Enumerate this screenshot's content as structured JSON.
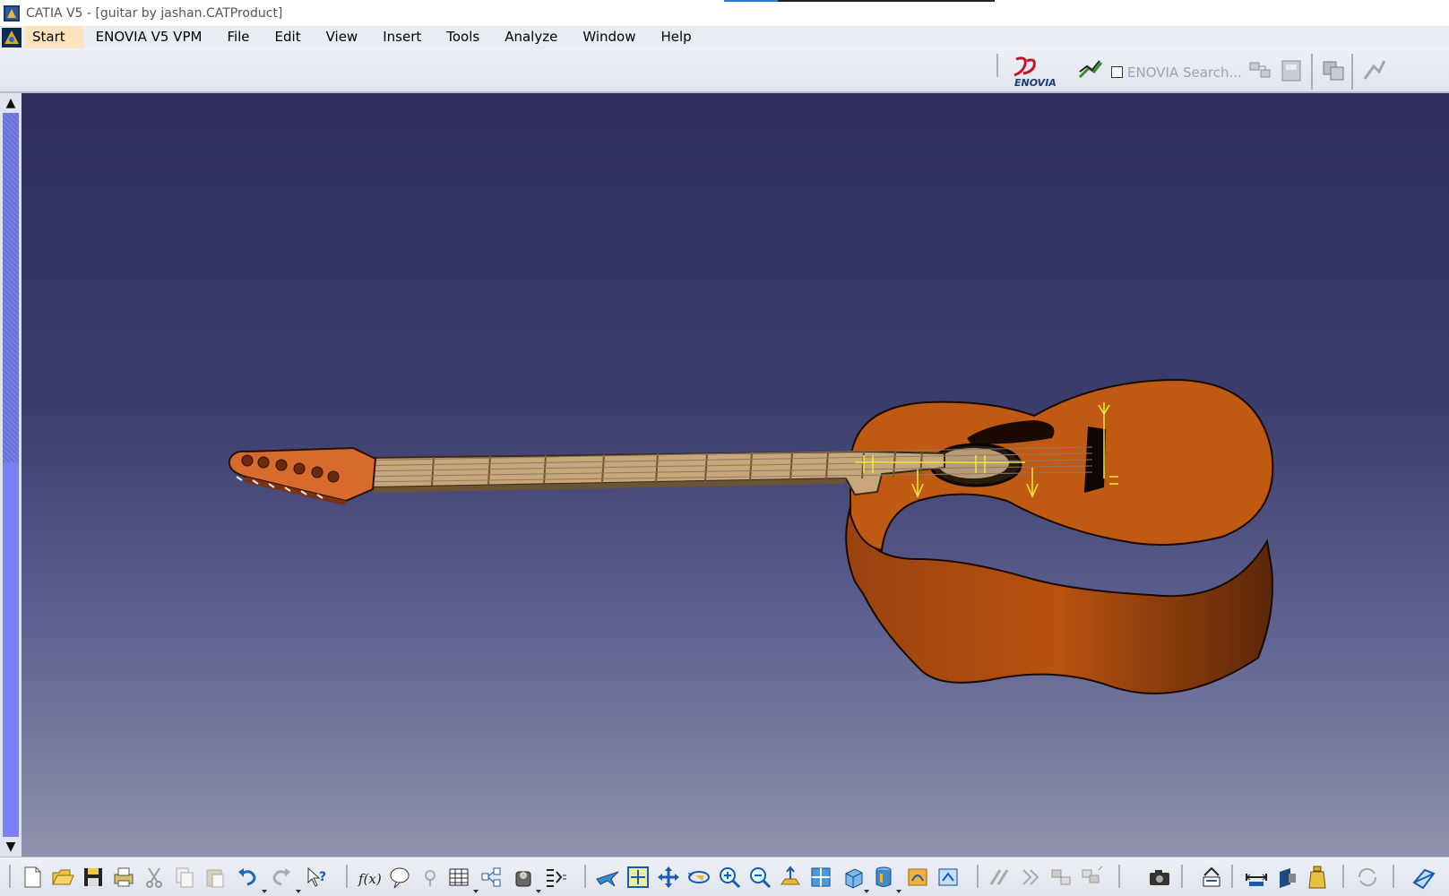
{
  "window": {
    "title": "CATIA V5 - [guitar by jashan.CATProduct]"
  },
  "menu": {
    "items": [
      {
        "label": "Start",
        "active": true
      },
      {
        "label": "ENOVIA V5 VPM"
      },
      {
        "label": "File"
      },
      {
        "label": "Edit"
      },
      {
        "label": "View"
      },
      {
        "label": "Insert"
      },
      {
        "label": "Tools"
      },
      {
        "label": "Analyze"
      },
      {
        "label": "Window"
      },
      {
        "label": "Help"
      }
    ]
  },
  "top_toolbar": {
    "enovia_search_label": "ENOVIA Search...",
    "enovia_search_checked": false,
    "icons": [
      "enovia-logo-icon",
      "enovia-search-icon",
      "connect-icon",
      "save-to-enovia-icon",
      "open-from-enovia-icon",
      "toggle-icon"
    ]
  },
  "viewport": {
    "model": "guitar",
    "background_top": "#2e2d5e",
    "background_bottom": "#8f91ad",
    "body_color": "#c25a10",
    "neck_color": "#c9a77a",
    "headstock_color": "#d96a2e",
    "constraint_color": "#e6ee3a"
  },
  "scrollbar": {
    "up_arrow": "▲",
    "down_arrow": "▼"
  },
  "bottom_toolbar": {
    "icons": [
      "new-icon",
      "open-icon",
      "save-icon",
      "print-icon",
      "cut-icon",
      "copy-icon",
      "paste-icon",
      "undo-icon",
      "redo-icon",
      "whats-this-icon",
      "formula-icon",
      "knowledge-advisor-icon",
      "light-icon",
      "table-icon",
      "catalog-icon",
      "macro-icon",
      "design-table-icon",
      "fly-mode-icon",
      "fit-all-icon",
      "pan-icon",
      "rotate-icon",
      "zoom-in-icon",
      "zoom-out-icon",
      "normal-view-icon",
      "multi-view-icon",
      "iso-view-icon",
      "shading-icon",
      "hide-show-icon",
      "swap-space-icon",
      "constraint-icon",
      "fix-icon",
      "explode-icon",
      "manipulation-icon",
      "camera-icon",
      "snap-icon",
      "measure-icon",
      "sectioning-icon",
      "weight-icon",
      "update-icon",
      "3d-compass-icon"
    ]
  }
}
